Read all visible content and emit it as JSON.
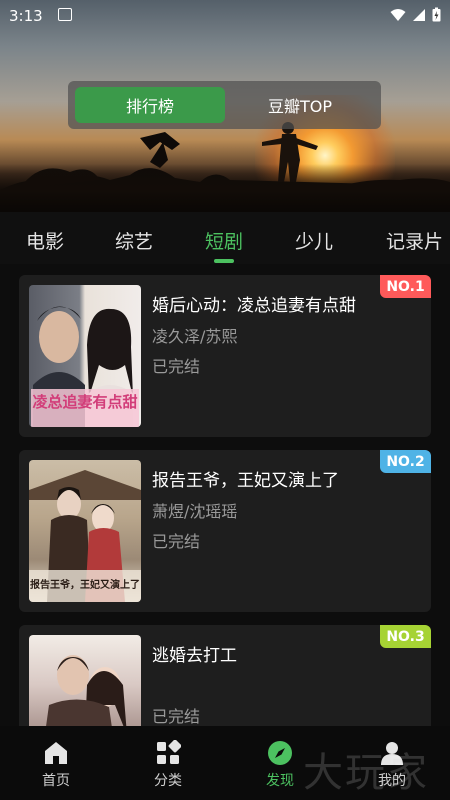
{
  "status_bar": {
    "time": "3:13"
  },
  "hero": {
    "segments": [
      {
        "label": "排行榜",
        "active": true
      },
      {
        "label": "豆瓣TOP",
        "active": false
      }
    ]
  },
  "category_tabs": [
    {
      "label": "电影",
      "active": false
    },
    {
      "label": "综艺",
      "active": false
    },
    {
      "label": "短剧",
      "active": true
    },
    {
      "label": "少儿",
      "active": false
    },
    {
      "label": "记录片",
      "active": false
    }
  ],
  "list": [
    {
      "rank": "NO.1",
      "rank_color": "#ff5a5a",
      "title": "婚后心动：凌总追妻有点甜",
      "actors": "凌久泽/苏熙",
      "status": "已完结",
      "poster_text": "凌总追妻有点甜"
    },
    {
      "rank": "NO.2",
      "rank_color": "#4fb3e6",
      "title": "报告王爷，王妃又演上了",
      "actors": "萧煜/沈瑶瑶",
      "status": "已完结",
      "poster_text": "报告王爷，王妃又演上了"
    },
    {
      "rank": "NO.3",
      "rank_color": "#a6d334",
      "title": "逃婚去打工",
      "actors": "",
      "status": "已完结",
      "poster_text": ""
    }
  ],
  "bottom_nav": [
    {
      "label": "首页",
      "icon": "home-icon",
      "active": false
    },
    {
      "label": "分类",
      "icon": "category-icon",
      "active": false
    },
    {
      "label": "发现",
      "icon": "compass-icon",
      "active": true
    },
    {
      "label": "我的",
      "icon": "user-icon",
      "active": false
    }
  ],
  "watermark": "大玩家",
  "colors": {
    "accent": "#4cc160",
    "card_bg": "#1e1e1e",
    "page_bg": "#0d0d0d"
  }
}
